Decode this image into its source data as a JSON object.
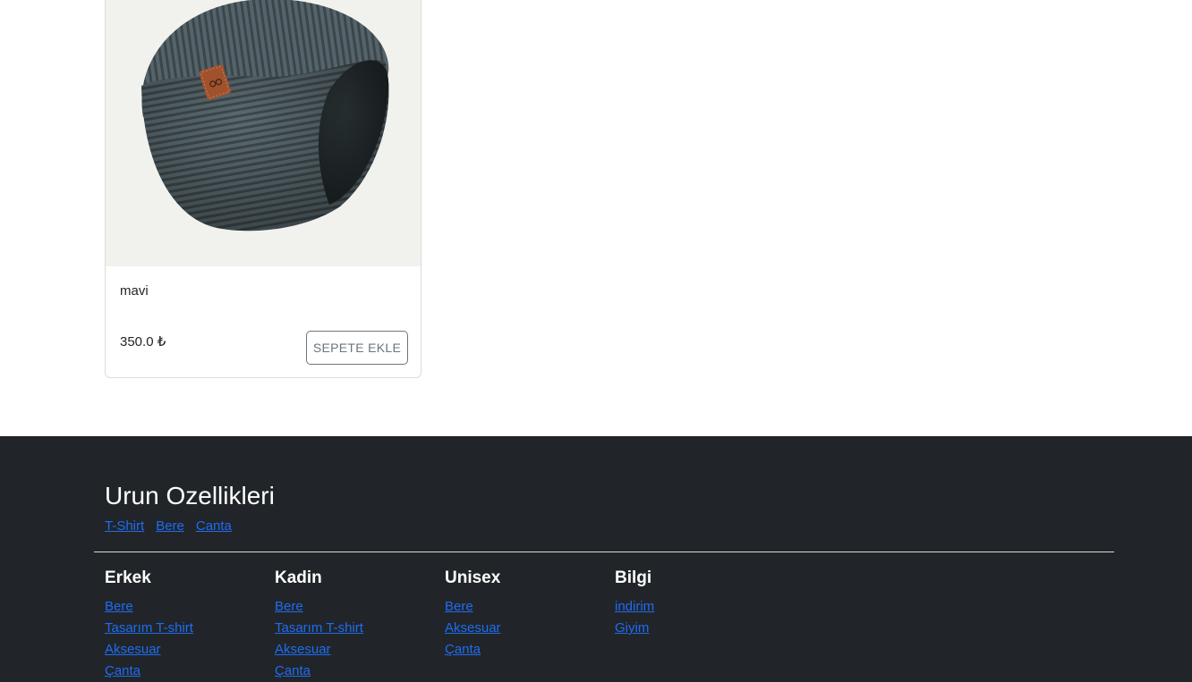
{
  "product": {
    "name": "mavi",
    "price": "350.0 ₺",
    "button_label": "SEPETE EKLE",
    "image_subject": "beanie-hat"
  },
  "footer": {
    "title": "Urun Ozellikleri",
    "feature_links": [
      "T-Shirt",
      "Bere",
      "Canta"
    ],
    "columns": [
      {
        "heading": "Erkek",
        "links": [
          "Bere",
          "Tasarım T-shirt",
          "Aksesuar",
          "Çanta"
        ]
      },
      {
        "heading": "Kadin",
        "links": [
          "Bere",
          "Tasarım T-shirt",
          "Aksesuar",
          "Çanta"
        ]
      },
      {
        "heading": "Unisex",
        "links": [
          "Bere",
          "Aksesuar",
          "Çanta"
        ]
      },
      {
        "heading": "Bilgi",
        "links": [
          "indirim",
          "Giyim"
        ]
      }
    ]
  },
  "colors": {
    "footer_bg": "#212529",
    "link": "#1f6cf2",
    "image_bg": "#f1f2ee",
    "beanie": "#4d5a5c",
    "leather_tag": "#a0522d"
  }
}
